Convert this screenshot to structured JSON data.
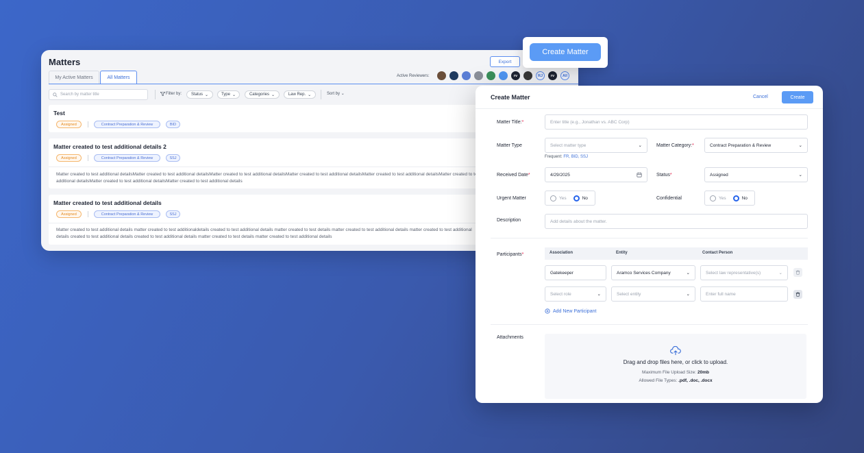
{
  "matters_window": {
    "title": "Matters",
    "export_label": "Export",
    "tabs": [
      {
        "label": "My Active Matters",
        "active": false
      },
      {
        "label": "All Matters",
        "active": true
      }
    ],
    "active_reviewers_label": "Active Reviewers:",
    "reviewers": [
      {
        "initials": "",
        "color": "#6b4f3a"
      },
      {
        "initials": "",
        "color": "#1f3a5f"
      },
      {
        "initials": "",
        "color": "#5b7fd6"
      },
      {
        "initials": "",
        "color": "#8a8f99"
      },
      {
        "initials": "",
        "color": "#3a8f5b"
      },
      {
        "initials": "",
        "color": "#4d94f0"
      },
      {
        "initials": "rv",
        "color": "#1e2433"
      },
      {
        "initials": "",
        "color": "#3a3a3a"
      },
      {
        "initials": "RJ",
        "color": "#eef3ff"
      },
      {
        "initials": "rv",
        "color": "#1e2433"
      },
      {
        "initials": "All",
        "color": "#eef3ff"
      }
    ],
    "search_placeholder": "Search by matter title",
    "filter_label": "Filter by:",
    "filters": [
      "Status",
      "Type",
      "Categories",
      "Law Rep."
    ],
    "sort_label": "Sort by",
    "cards": [
      {
        "title": "Test",
        "status": "Assigned",
        "category": "Contract Preparation & Review",
        "type": "BID",
        "description": ""
      },
      {
        "title": "Matter created to test additional details 2",
        "status": "Assigned",
        "category": "Contract Preparation & Review",
        "type": "SSJ",
        "description": "Matter created to test additional detailsMatter created to test additional detailsMatter created to test additional detailsMatter created to test additional detailsMatter created to test additional detailsMatter created to test additional detailsMatter created to test additional detailsMatter created to test additional details"
      },
      {
        "title": "Matter created to test additional details",
        "status": "Assigned",
        "category": "Contract Preparation & Review",
        "type": "SSJ",
        "description": "Matter created to test additional details matter created to test additionaldetails created to test additional details matter created to test details matter created to test additional details matter created to test additional details created to test additional details created to test additional details matter created to test details matter created to test additional details"
      }
    ]
  },
  "callout": {
    "create_label": "Create Matter"
  },
  "modal": {
    "title": "Create Matter",
    "cancel_label": "Cancel",
    "create_label": "Create",
    "matter_title": {
      "label": "Matter Title:",
      "placeholder": "Enter title (e.g., Jonathan vs. ABC Corp)"
    },
    "matter_type": {
      "label": "Matter Type",
      "placeholder": "Select matter type",
      "frequent_label": "Frequent:",
      "frequent_values": "FR, BID, SSJ"
    },
    "matter_category": {
      "label": "Matter Category:",
      "value": "Contract Preparation & Review"
    },
    "received_date": {
      "label": "Received Date",
      "value": "4/29/2025"
    },
    "status": {
      "label": "Status",
      "value": "Assigned"
    },
    "urgent": {
      "label": "Urgent Matter",
      "yes": "Yes",
      "no": "No",
      "selected": "No"
    },
    "confidential": {
      "label": "Confidential",
      "yes": "Yes",
      "no": "No",
      "selected": "No"
    },
    "description": {
      "label": "Description",
      "placeholder": "Add details about the matter."
    },
    "participants": {
      "label": "Participants",
      "headers": [
        "Association",
        "Entity",
        "Contact Person"
      ],
      "rows": [
        {
          "association": "Gatekeeper",
          "entity": "Aramco Services Company",
          "contact_placeholder": "Select law representative(s)"
        },
        {
          "association_placeholder": "Select role",
          "entity_placeholder": "Select entity",
          "contact_placeholder": "Enter full name"
        }
      ],
      "add_label": "Add New Participant"
    },
    "attachments": {
      "label": "Attachments",
      "main_text": "Drag and drop files here, or click to upload.",
      "max_size_label": "Maximum File Upload Size:",
      "max_size_value": "20mb",
      "types_label": "Allowed File Types:",
      "types_value": ".pdf, .doc, .docx"
    }
  }
}
